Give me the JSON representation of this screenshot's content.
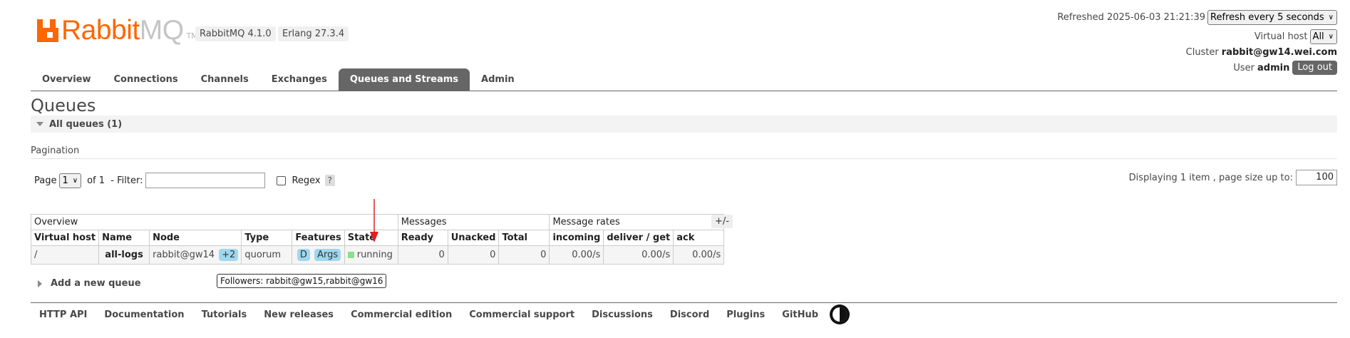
{
  "app": {
    "logo_rabbit": "Rabbit",
    "logo_mq": "MQ",
    "logo_tm": "TM",
    "version": "RabbitMQ 4.1.0",
    "erlang": "Erlang 27.3.4"
  },
  "status": {
    "refreshed_label": "Refreshed",
    "refreshed_time": "2025-06-03 21:21:39",
    "refresh_select": "Refresh every 5 seconds",
    "vhost_label": "Virtual host",
    "vhost_select": "All",
    "cluster_label": "Cluster",
    "cluster_name": "rabbit@gw14.wei.com",
    "user_label": "User",
    "user_name": "admin",
    "logout": "Log out"
  },
  "tabs": [
    {
      "label": "Overview"
    },
    {
      "label": "Connections"
    },
    {
      "label": "Channels"
    },
    {
      "label": "Exchanges"
    },
    {
      "label": "Queues and Streams",
      "active": true
    },
    {
      "label": "Admin"
    }
  ],
  "page": {
    "title": "Queues",
    "section": "All queues (1)",
    "pagination_label": "Pagination",
    "page_label": "Page",
    "page_value": "1",
    "of_label": "of 1",
    "filter_label": "- Filter:",
    "filter_value": "",
    "regex_label": "Regex",
    "help": "?",
    "displaying": "Displaying 1 item , page size up to:",
    "page_size": "100",
    "plus_minus": "+/-",
    "add_queue": "Add a new queue"
  },
  "table": {
    "groups": [
      "Overview",
      "Messages",
      "Message rates"
    ],
    "columns": [
      "Virtual host",
      "Name",
      "Node",
      "Type",
      "Features",
      "State",
      "Ready",
      "Unacked",
      "Total",
      "incoming",
      "deliver / get",
      "ack"
    ],
    "rows": [
      {
        "vhost": "/",
        "name": "all-logs",
        "node": "rabbit@gw14",
        "node_extra": "+2",
        "type": "quorum",
        "feature_d": "D",
        "feature_args": "Args",
        "state": "running",
        "ready": "0",
        "unacked": "0",
        "total": "0",
        "incoming": "0.00/s",
        "deliver_get": "0.00/s",
        "ack": "0.00/s"
      }
    ]
  },
  "tooltip": "Followers: rabbit@gw15,rabbit@gw16",
  "footer": [
    "HTTP API",
    "Documentation",
    "Tutorials",
    "New releases",
    "Commercial edition",
    "Commercial support",
    "Discussions",
    "Discord",
    "Plugins",
    "GitHub"
  ],
  "colors": {
    "brand": "#ff6600",
    "tab_active": "#666666",
    "running": "#8cdf8c",
    "pill": "#9ed8f0"
  }
}
